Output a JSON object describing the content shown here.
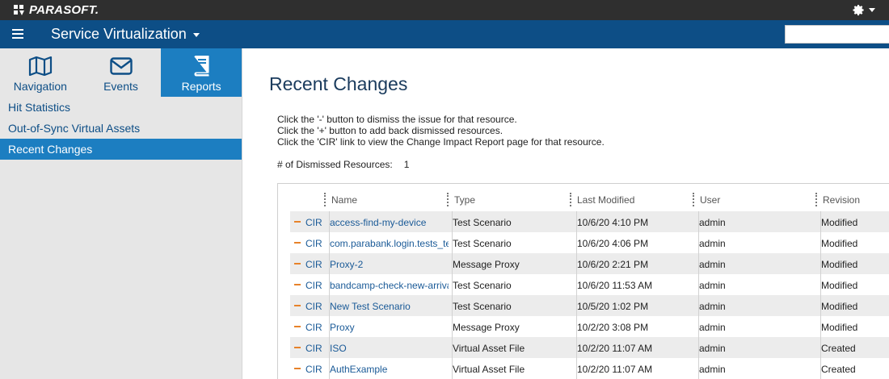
{
  "brand": {
    "name": "PARASOFT."
  },
  "header": {
    "app_title": "Service Virtualization"
  },
  "sidebar": {
    "tabs": [
      {
        "label": "Navigation",
        "icon": "map-icon"
      },
      {
        "label": "Events",
        "icon": "envelope-icon"
      },
      {
        "label": "Reports",
        "icon": "book-icon",
        "active": true
      }
    ],
    "items": [
      {
        "label": "Hit Statistics"
      },
      {
        "label": "Out-of-Sync Virtual Assets"
      },
      {
        "label": "Recent Changes",
        "active": true
      }
    ]
  },
  "main": {
    "title": "Recent Changes",
    "instructions": [
      "Click the '-' button to dismiss the issue for that resource.",
      "Click the '+' button to add back dismissed resources.",
      "Click the 'CIR' link to view the Change Impact Report page for that resource."
    ],
    "dismissed_label": "# of Dismissed Resources:",
    "dismissed_count": "1"
  },
  "table": {
    "headers": [
      "Name",
      "Type",
      "Last Modified",
      "User",
      "Revision"
    ],
    "cir_label": "CIR",
    "rows": [
      {
        "name": "access-find-my-device",
        "type": "Test Scenario",
        "modified": "10/6/20 4:10 PM",
        "user": "admin",
        "revision": "Modified"
      },
      {
        "name": "com.parabank.login.tests_test",
        "type": "Test Scenario",
        "modified": "10/6/20 4:06 PM",
        "user": "admin",
        "revision": "Modified"
      },
      {
        "name": "Proxy-2",
        "type": "Message Proxy",
        "modified": "10/6/20 2:21 PM",
        "user": "admin",
        "revision": "Modified"
      },
      {
        "name": "bandcamp-check-new-arrivals",
        "type": "Test Scenario",
        "modified": "10/6/20 11:53 AM",
        "user": "admin",
        "revision": "Modified"
      },
      {
        "name": "New Test Scenario",
        "type": "Test Scenario",
        "modified": "10/5/20 1:02 PM",
        "user": "admin",
        "revision": "Modified"
      },
      {
        "name": "Proxy",
        "type": "Message Proxy",
        "modified": "10/2/20 3:08 PM",
        "user": "admin",
        "revision": "Modified"
      },
      {
        "name": "ISO",
        "type": "Virtual Asset File",
        "modified": "10/2/20 11:07 AM",
        "user": "admin",
        "revision": "Created"
      },
      {
        "name": "AuthExample",
        "type": "Virtual Asset File",
        "modified": "10/2/20 11:07 AM",
        "user": "admin",
        "revision": "Created"
      }
    ]
  },
  "colors": {
    "brand_bar": "#2f2f2f",
    "app_bar": "#0d4e86",
    "active_blue": "#1c7ec1",
    "dismiss_orange": "#e7822a",
    "link_blue": "#1a5a97"
  }
}
